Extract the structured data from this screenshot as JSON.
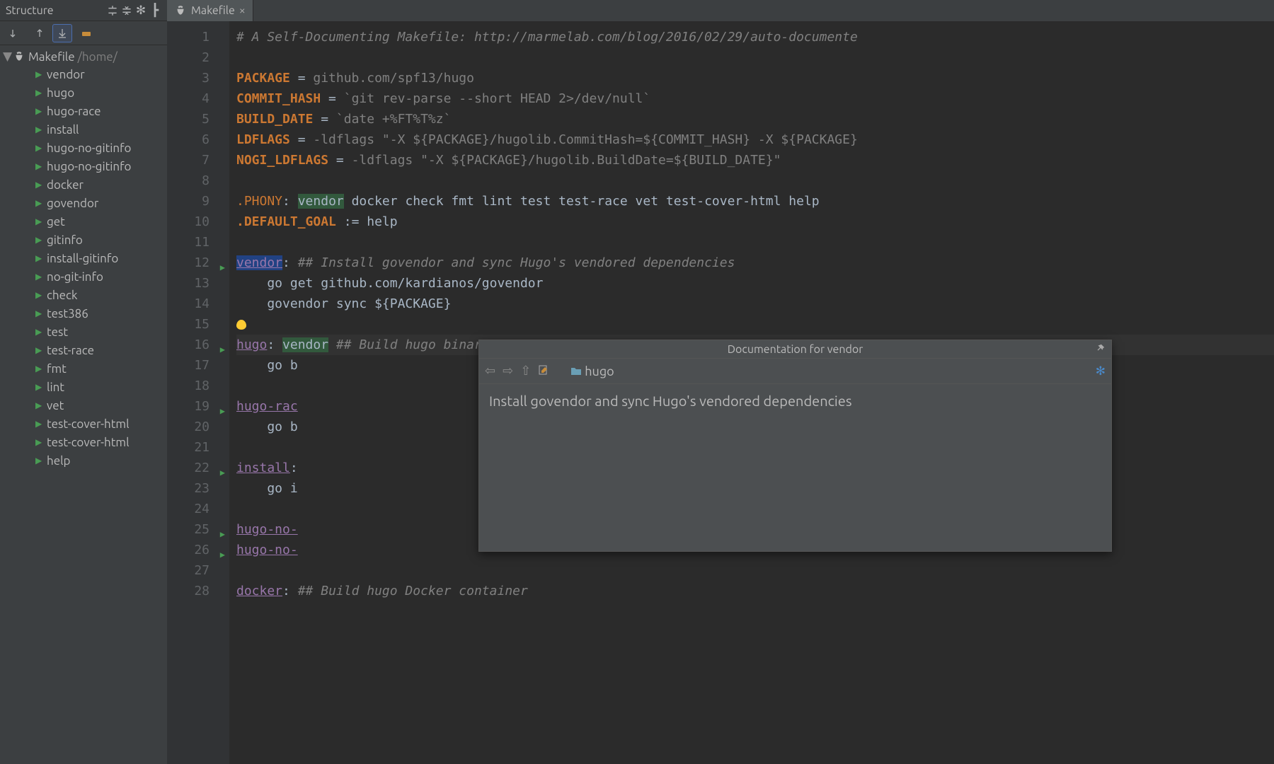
{
  "sidebar": {
    "title": "Structure",
    "root_label": "Makefile",
    "root_path": "/home/",
    "items": [
      {
        "label": "vendor"
      },
      {
        "label": "hugo"
      },
      {
        "label": "hugo-race"
      },
      {
        "label": "install"
      },
      {
        "label": "hugo-no-gitinfo"
      },
      {
        "label": "hugo-no-gitinfo"
      },
      {
        "label": "docker"
      },
      {
        "label": "govendor"
      },
      {
        "label": "get"
      },
      {
        "label": "gitinfo"
      },
      {
        "label": "install-gitinfo"
      },
      {
        "label": "no-git-info"
      },
      {
        "label": "check"
      },
      {
        "label": "test386"
      },
      {
        "label": "test"
      },
      {
        "label": "test-race"
      },
      {
        "label": "fmt"
      },
      {
        "label": "lint"
      },
      {
        "label": "vet"
      },
      {
        "label": "test-cover-html"
      },
      {
        "label": "test-cover-html"
      },
      {
        "label": "help"
      }
    ]
  },
  "tab": {
    "label": "Makefile"
  },
  "code": {
    "lines": [
      {
        "n": 1,
        "segs": [
          {
            "t": "# A Self-Documenting Makefile: http://marmelab.com/blog/2016/02/29/auto-documente",
            "cls": "c-comment"
          }
        ]
      },
      {
        "n": 2,
        "segs": []
      },
      {
        "n": 3,
        "segs": [
          {
            "t": "PACKAGE",
            "cls": "c-var"
          },
          {
            "t": " = "
          },
          {
            "t": "github.com/spf13/hugo",
            "cls": "c-str"
          }
        ]
      },
      {
        "n": 4,
        "segs": [
          {
            "t": "COMMIT_HASH",
            "cls": "c-var"
          },
          {
            "t": " = "
          },
          {
            "t": "`git rev-parse --short HEAD 2>/dev/null`",
            "cls": "c-str"
          }
        ]
      },
      {
        "n": 5,
        "segs": [
          {
            "t": "BUILD_DATE",
            "cls": "c-var"
          },
          {
            "t": " = "
          },
          {
            "t": "`date +%FT%T%z`",
            "cls": "c-str"
          }
        ]
      },
      {
        "n": 6,
        "segs": [
          {
            "t": "LDFLAGS",
            "cls": "c-var"
          },
          {
            "t": " = "
          },
          {
            "t": "-ldflags \"-X ${PACKAGE}/hugolib.CommitHash=${COMMIT_HASH} -X ${PACKAGE}",
            "cls": "c-str"
          }
        ]
      },
      {
        "n": 7,
        "segs": [
          {
            "t": "NOGI_LDFLAGS",
            "cls": "c-var"
          },
          {
            "t": " = "
          },
          {
            "t": "-ldflags \"-X ${PACKAGE}/hugolib.BuildDate=${BUILD_DATE}\"",
            "cls": "c-str"
          }
        ]
      },
      {
        "n": 8,
        "segs": []
      },
      {
        "n": 9,
        "segs": [
          {
            "t": ".PHONY",
            "cls": "c-kw"
          },
          {
            "t": ": "
          },
          {
            "t": "vendor",
            "cls": "c-hl"
          },
          {
            "t": " docker check fmt lint test test-race vet test-cover-html help"
          }
        ]
      },
      {
        "n": 10,
        "segs": [
          {
            "t": ".DEFAULT_GOAL",
            "cls": "c-var"
          },
          {
            "t": " := help"
          }
        ]
      },
      {
        "n": 11,
        "segs": []
      },
      {
        "n": 12,
        "fold": true,
        "segs": [
          {
            "t": "vendor",
            "cls": "c-tsel"
          },
          {
            "t": ": "
          },
          {
            "t": "## Install govendor and sync Hugo's vendored dependencies",
            "cls": "c-comment"
          }
        ]
      },
      {
        "n": 13,
        "segs": [
          {
            "t": "    go get github.com/kardianos/govendor"
          }
        ]
      },
      {
        "n": 14,
        "segs": [
          {
            "t": "    govendor sync ${PACKAGE}"
          }
        ]
      },
      {
        "n": 15,
        "bulb": true,
        "segs": []
      },
      {
        "n": 16,
        "fold": true,
        "sel": true,
        "segs": [
          {
            "t": "hugo",
            "cls": "c-target"
          },
          {
            "t": ": "
          },
          {
            "t": "vendor",
            "cls": "c-hl"
          },
          {
            "t": " "
          },
          {
            "t": "## Build hugo binary",
            "cls": "c-comment"
          }
        ]
      },
      {
        "n": 17,
        "segs": [
          {
            "t": "    go b"
          }
        ]
      },
      {
        "n": 18,
        "segs": []
      },
      {
        "n": 19,
        "fold": true,
        "segs": [
          {
            "t": "hugo-rac",
            "cls": "c-target"
          }
        ]
      },
      {
        "n": 20,
        "segs": [
          {
            "t": "    go b"
          }
        ]
      },
      {
        "n": 21,
        "segs": []
      },
      {
        "n": 22,
        "fold": true,
        "segs": [
          {
            "t": "install",
            "cls": "c-target"
          },
          {
            "t": ":"
          }
        ]
      },
      {
        "n": 23,
        "segs": [
          {
            "t": "    go i"
          }
        ]
      },
      {
        "n": 24,
        "segs": []
      },
      {
        "n": 25,
        "fold": true,
        "segs": [
          {
            "t": "hugo-no-",
            "cls": "c-target"
          }
        ]
      },
      {
        "n": 26,
        "fold": true,
        "segs": [
          {
            "t": "hugo-no-",
            "cls": "c-target"
          }
        ]
      },
      {
        "n": 27,
        "segs": []
      },
      {
        "n": 28,
        "segs": [
          {
            "t": "docker",
            "cls": "c-target"
          },
          {
            "t": ": "
          },
          {
            "t": "## Build hugo Docker container",
            "cls": "c-comment"
          }
        ]
      }
    ]
  },
  "popup": {
    "title": "Documentation for vendor",
    "project": "hugo",
    "body": "Install govendor and sync Hugo's vendored dependencies"
  }
}
